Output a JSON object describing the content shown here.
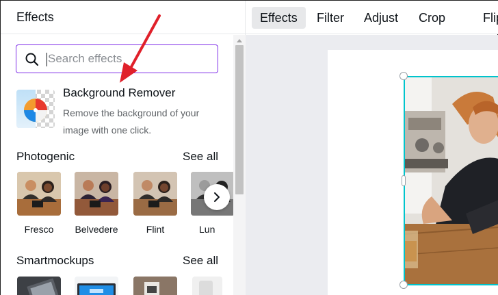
{
  "panel": {
    "title": "Effects",
    "search": {
      "placeholder": "Search effects",
      "value": ""
    },
    "background_remover": {
      "title": "Background Remover",
      "description": "Remove the background of your image with one click."
    },
    "photogenic": {
      "title": "Photogenic",
      "see_all": "See all",
      "items": [
        {
          "label": "Fresco"
        },
        {
          "label": "Belvedere"
        },
        {
          "label": "Flint"
        },
        {
          "label": "Lun"
        }
      ]
    },
    "smartmockups": {
      "title": "Smartmockups",
      "see_all": "See all"
    }
  },
  "toolbar": {
    "items": [
      {
        "label": "Effects",
        "active": true
      },
      {
        "label": "Filter",
        "active": false
      },
      {
        "label": "Adjust",
        "active": false
      },
      {
        "label": "Crop",
        "active": false
      },
      {
        "label": "Flip",
        "active": false
      }
    ]
  },
  "icons": {
    "search": "search-icon",
    "next": "chevron-right-icon",
    "annotation": "red-arrow-icon"
  },
  "colors": {
    "accent": "#7d2ae8",
    "selection": "#00c4cc",
    "arrow": "#e0202a",
    "active_tab": "#e7e8ea"
  }
}
